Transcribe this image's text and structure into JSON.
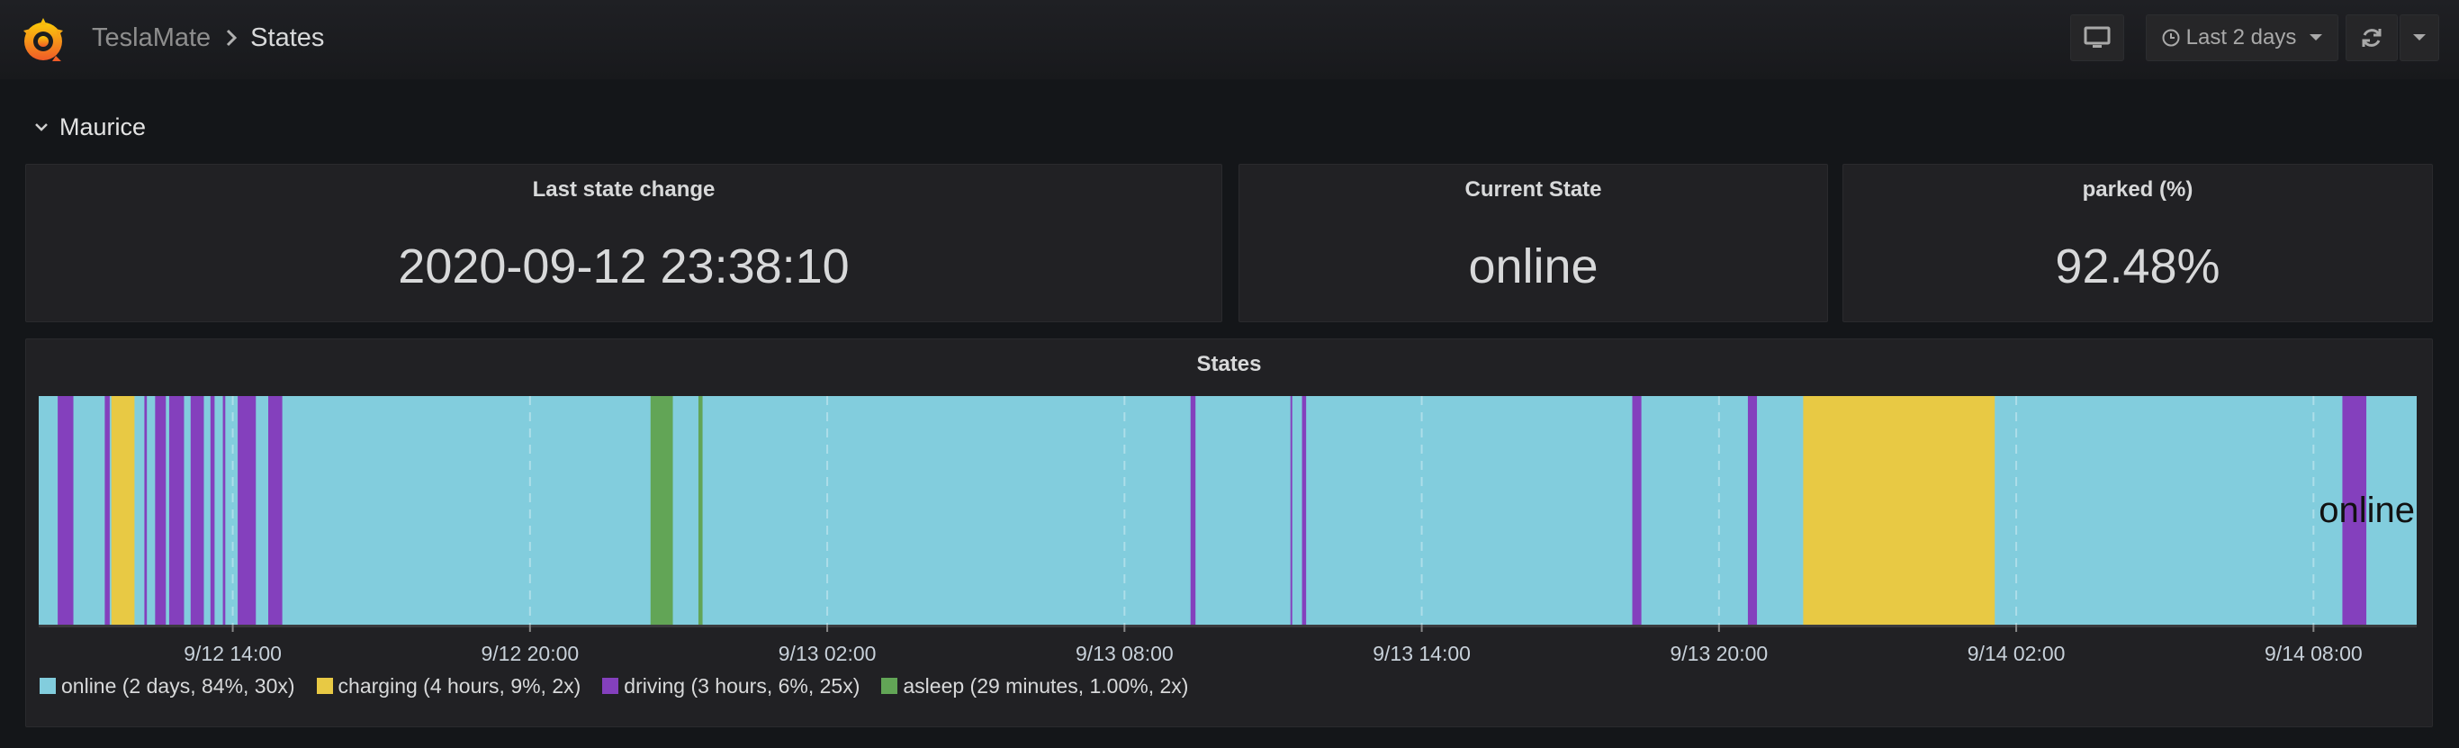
{
  "header": {
    "breadcrumb_parent": "TeslaMate",
    "breadcrumb_current": "States",
    "time_range_label": "Last 2 days",
    "icons": {
      "logo": "grafana-logo-icon",
      "tv": "monitor-icon",
      "clock": "clock-icon",
      "refresh": "refresh-icon",
      "caret": "caret-down-icon"
    }
  },
  "row": {
    "title": "Maurice"
  },
  "panels": {
    "last_state_change": {
      "title": "Last state change",
      "value": "2020-09-12 23:38:10"
    },
    "current_state": {
      "title": "Current State",
      "value": "online"
    },
    "parked": {
      "title": "parked (%)",
      "value": "92.48%"
    }
  },
  "states_panel": {
    "title": "States",
    "end_label": "online"
  },
  "colors": {
    "online": "#82cddd",
    "charging": "#e8c944",
    "driving": "#8440bd",
    "asleep": "#62a556"
  },
  "chart_data": {
    "type": "state-timeline",
    "title": "States",
    "x_range": [
      "9/12 10:05",
      "9/14 10:05"
    ],
    "x_ticks": [
      "9/12 14:00",
      "9/12 20:00",
      "9/13 02:00",
      "9/13 08:00",
      "9/13 14:00",
      "9/13 20:00",
      "9/14 02:00",
      "9/14 08:00"
    ],
    "default_state": "online",
    "segments": [
      {
        "state": "driving",
        "start": "9/12 10:28",
        "end": "9/12 10:47"
      },
      {
        "state": "driving",
        "start": "9/12 11:25",
        "end": "9/12 11:31"
      },
      {
        "state": "charging",
        "start": "9/12 11:33",
        "end": "9/12 12:01"
      },
      {
        "state": "driving",
        "start": "9/12 12:13",
        "end": "9/12 12:16"
      },
      {
        "state": "driving",
        "start": "9/12 12:26",
        "end": "9/12 12:39"
      },
      {
        "state": "driving",
        "start": "9/12 12:43",
        "end": "9/12 13:01"
      },
      {
        "state": "driving",
        "start": "9/12 13:09",
        "end": "9/12 13:25"
      },
      {
        "state": "driving",
        "start": "9/12 13:33",
        "end": "9/12 13:38"
      },
      {
        "state": "driving",
        "start": "9/12 13:48",
        "end": "9/12 13:51"
      },
      {
        "state": "driving",
        "start": "9/12 14:06",
        "end": "9/12 14:28"
      },
      {
        "state": "driving",
        "start": "9/12 14:43",
        "end": "9/12 15:00"
      },
      {
        "state": "asleep",
        "start": "9/12 22:26",
        "end": "9/12 22:53"
      },
      {
        "state": "asleep",
        "start": "9/12 23:24",
        "end": "9/12 23:29"
      },
      {
        "state": "driving",
        "start": "9/13 09:20",
        "end": "9/13 09:26"
      },
      {
        "state": "driving",
        "start": "9/13 11:21",
        "end": "9/13 11:23"
      },
      {
        "state": "driving",
        "start": "9/13 11:35",
        "end": "9/13 11:40"
      },
      {
        "state": "driving",
        "start": "9/13 18:15",
        "end": "9/13 18:26"
      },
      {
        "state": "driving",
        "start": "9/13 20:35",
        "end": "9/13 20:46"
      },
      {
        "state": "charging",
        "start": "9/13 21:42",
        "end": "9/14 01:34"
      },
      {
        "state": "driving",
        "start": "9/14 08:35",
        "end": "9/14 09:04"
      }
    ],
    "legend": [
      {
        "state": "online",
        "label": "online (2 days, 84%, 30x)"
      },
      {
        "state": "charging",
        "label": "charging (4 hours, 9%, 2x)"
      },
      {
        "state": "driving",
        "label": "driving (3 hours, 6%, 25x)"
      },
      {
        "state": "asleep",
        "label": "asleep (29 minutes, 1.00%, 2x)"
      }
    ]
  }
}
